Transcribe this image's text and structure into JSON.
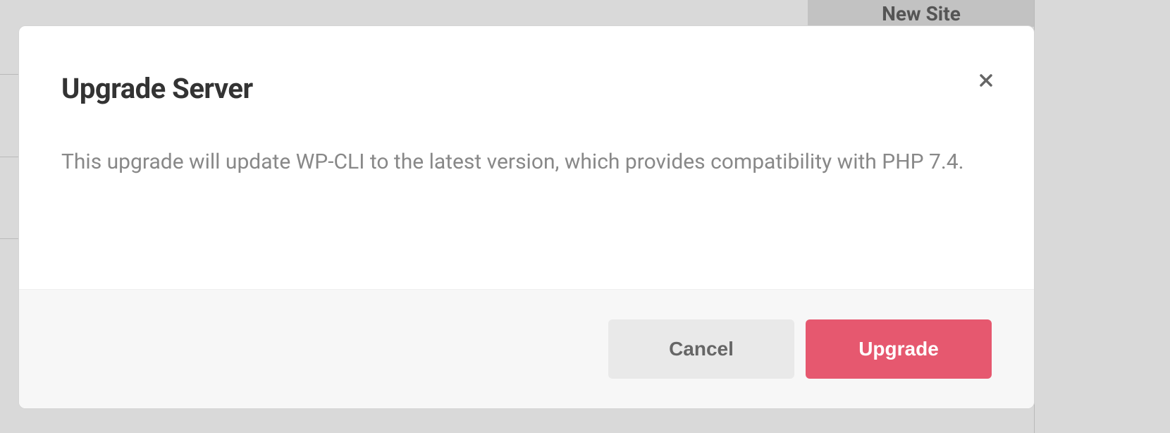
{
  "background": {
    "new_site_label": "New Site"
  },
  "modal": {
    "title": "Upgrade Server",
    "description": "This upgrade will update WP-CLI to the latest version, which provides compatibility with PHP 7.4.",
    "cancel_label": "Cancel",
    "upgrade_label": "Upgrade"
  }
}
